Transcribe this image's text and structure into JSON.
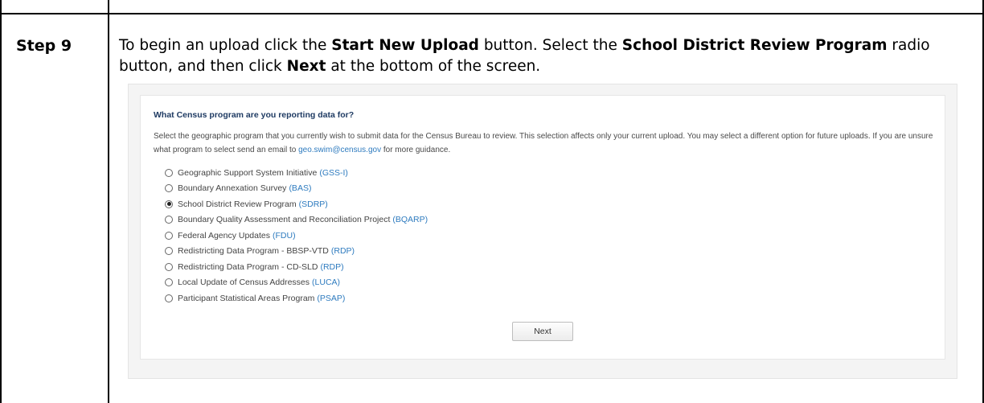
{
  "step": {
    "label": "Step 9"
  },
  "instructions": {
    "part1": "To begin an upload click the ",
    "start_btn": "Start New Upload",
    "part2": " button. Select the ",
    "program": "School District Review Program",
    "part3": " radio button, and then click ",
    "next": "Next",
    "part4": " at the bottom of the screen."
  },
  "form": {
    "question": "What Census program are you reporting data for?",
    "desc_part1": "Select the geographic program that you currently wish to submit data for the Census Bureau to review. This selection affects only your current upload. You may select a different option for future uploads. If you are unsure what program to select send an email to ",
    "email": "geo.swim@census.gov",
    "desc_part2": " for more guidance.",
    "options": [
      {
        "label": "Geographic Support System Initiative",
        "code": "(GSS-I)",
        "checked": false
      },
      {
        "label": "Boundary Annexation Survey",
        "code": "(BAS)",
        "checked": false
      },
      {
        "label": "School District Review Program",
        "code": "(SDRP)",
        "checked": true
      },
      {
        "label": "Boundary Quality Assessment and Reconciliation Project",
        "code": "(BQARP)",
        "checked": false
      },
      {
        "label": "Federal Agency Updates",
        "code": "(FDU)",
        "checked": false
      },
      {
        "label": "Redistricting Data Program - BBSP-VTD",
        "code": "(RDP)",
        "checked": false
      },
      {
        "label": "Redistricting Data Program - CD-SLD",
        "code": "(RDP)",
        "checked": false
      },
      {
        "label": "Local Update of Census Addresses",
        "code": "(LUCA)",
        "checked": false
      },
      {
        "label": "Participant Statistical Areas Program",
        "code": "(PSAP)",
        "checked": false
      }
    ],
    "next_label": "Next"
  }
}
